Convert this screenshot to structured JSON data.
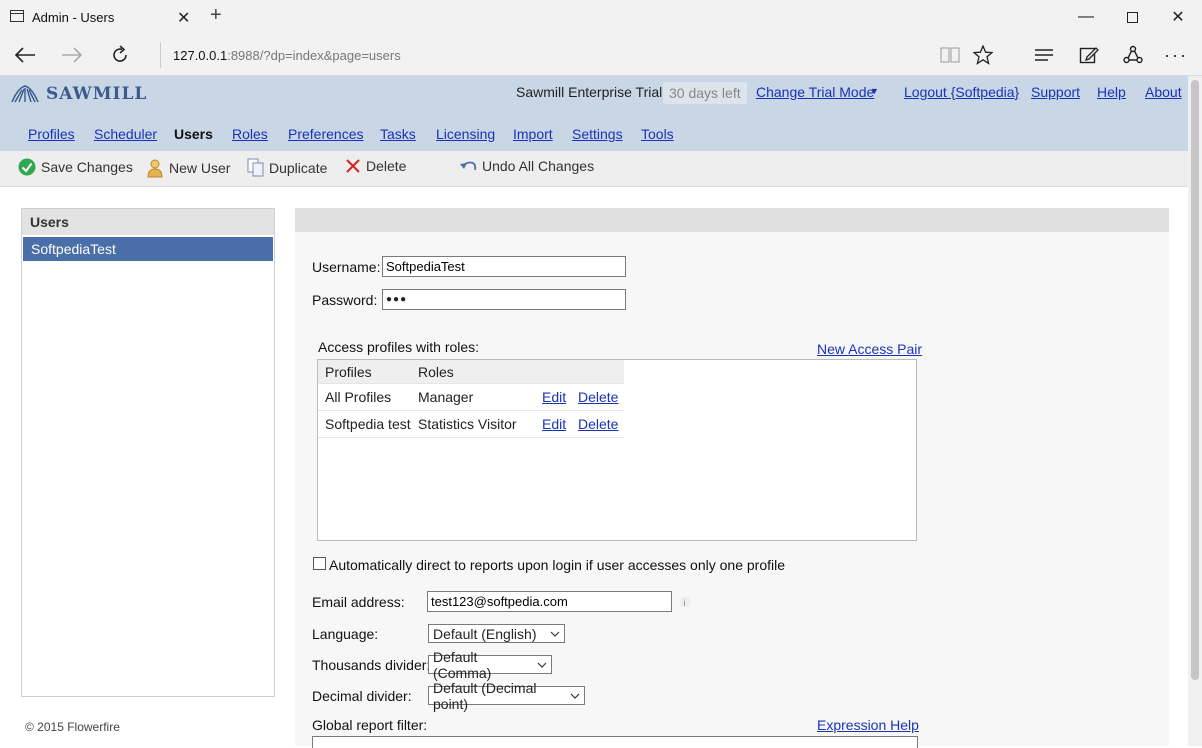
{
  "browser": {
    "tab_title": "Admin - Users",
    "url_host": "127.0.0.1",
    "url_path": ":8988/?dp=index&page=users"
  },
  "header": {
    "logo": "SAWMILL",
    "trial_label": "Sawmill Enterprise Trial",
    "days_left": "30 days left",
    "change_trial": "Change Trial Mode",
    "logout": "Logout {Softpedia}",
    "support": "Support",
    "help": "Help",
    "about": "About"
  },
  "menu": {
    "profiles": "Profiles",
    "scheduler": "Scheduler",
    "users": "Users",
    "roles": "Roles",
    "preferences": "Preferences",
    "tasks": "Tasks",
    "licensing": "Licensing",
    "import": "Import",
    "settings": "Settings",
    "tools": "Tools"
  },
  "toolbar": {
    "save": "Save Changes",
    "new_user": "New User",
    "duplicate": "Duplicate",
    "delete": "Delete",
    "undo": "Undo All Changes"
  },
  "users_panel": {
    "title": "Users",
    "selected": "SoftpediaTest",
    "copyright": "© 2015 Flowerfire"
  },
  "form": {
    "username_label": "Username:",
    "username_value": "SoftpediaTest",
    "password_label": "Password:",
    "password_value": "●●●",
    "access_label": "Access profiles with roles:",
    "new_access_pair": "New Access Pair",
    "col_profiles": "Profiles",
    "col_roles": "Roles",
    "rows": [
      {
        "profile": "All Profiles",
        "role": "Manager",
        "edit": "Edit",
        "delete": "Delete"
      },
      {
        "profile": "Softpedia test",
        "role": "Statistics Visitor",
        "edit": "Edit",
        "delete": "Delete"
      }
    ],
    "auto_direct": "Automatically direct to reports upon login if user accesses only one profile",
    "email_label": "Email address:",
    "email_value": "test123@softpedia.com",
    "language_label": "Language:",
    "language_value": "Default (English)",
    "thousands_label": "Thousands divider:",
    "thousands_value": "Default (Comma)",
    "decimal_label": "Decimal divider:",
    "decimal_value": "Default (Decimal point)",
    "global_filter_label": "Global report filter:",
    "expression_help": "Expression Help"
  }
}
